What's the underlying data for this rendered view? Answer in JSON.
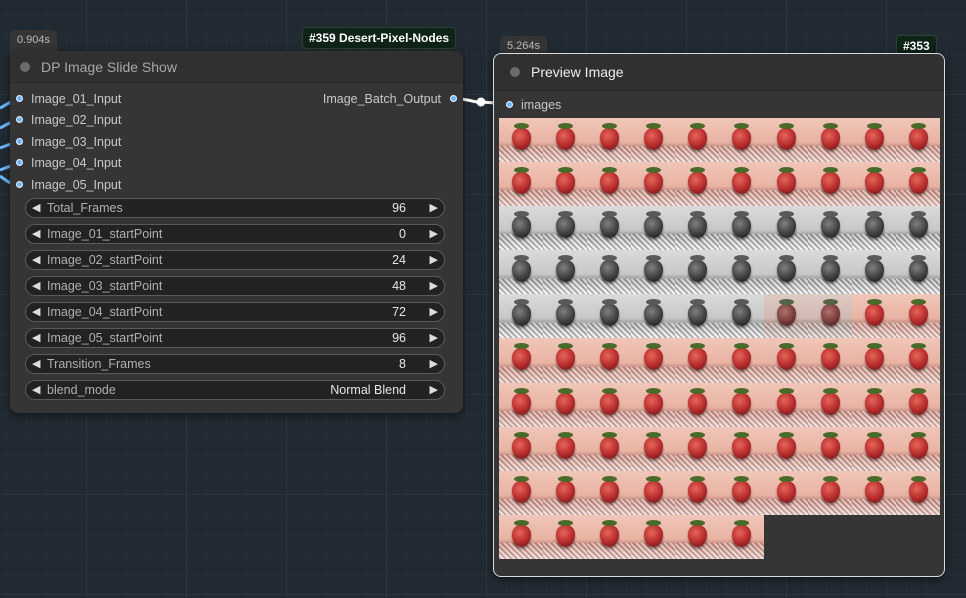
{
  "left_node": {
    "time": "0.904s",
    "id_badge": "#359 Desert-Pixel-Nodes",
    "title": "DP Image Slide Show",
    "inputs": [
      "Image_01_Input",
      "Image_02_Input",
      "Image_03_Input",
      "Image_04_Input",
      "Image_05_Input"
    ],
    "output": "Image_Batch_Output",
    "widgets": [
      {
        "label": "Total_Frames",
        "value": "96"
      },
      {
        "label": "Image_01_startPoint",
        "value": "0"
      },
      {
        "label": "Image_02_startPoint",
        "value": "24"
      },
      {
        "label": "Image_03_startPoint",
        "value": "48"
      },
      {
        "label": "Image_04_startPoint",
        "value": "72"
      },
      {
        "label": "Image_05_startPoint",
        "value": "96"
      },
      {
        "label": "Transition_Frames",
        "value": "8"
      },
      {
        "label": "blend_mode",
        "value": "Normal Blend"
      }
    ]
  },
  "right_node": {
    "time": "5.264s",
    "id_badge": "#353",
    "title": "Preview Image",
    "input": "images",
    "thumbnail_count": 96,
    "thumbnail_columns": 10,
    "thumbnail_subject": "strawberry"
  },
  "colors": {
    "canvas": "#212a32",
    "node_body": "#353535",
    "slot_dot": "#6cb7ff",
    "link": "#6cb7ff",
    "id_badge_bg": "#0f2318"
  }
}
